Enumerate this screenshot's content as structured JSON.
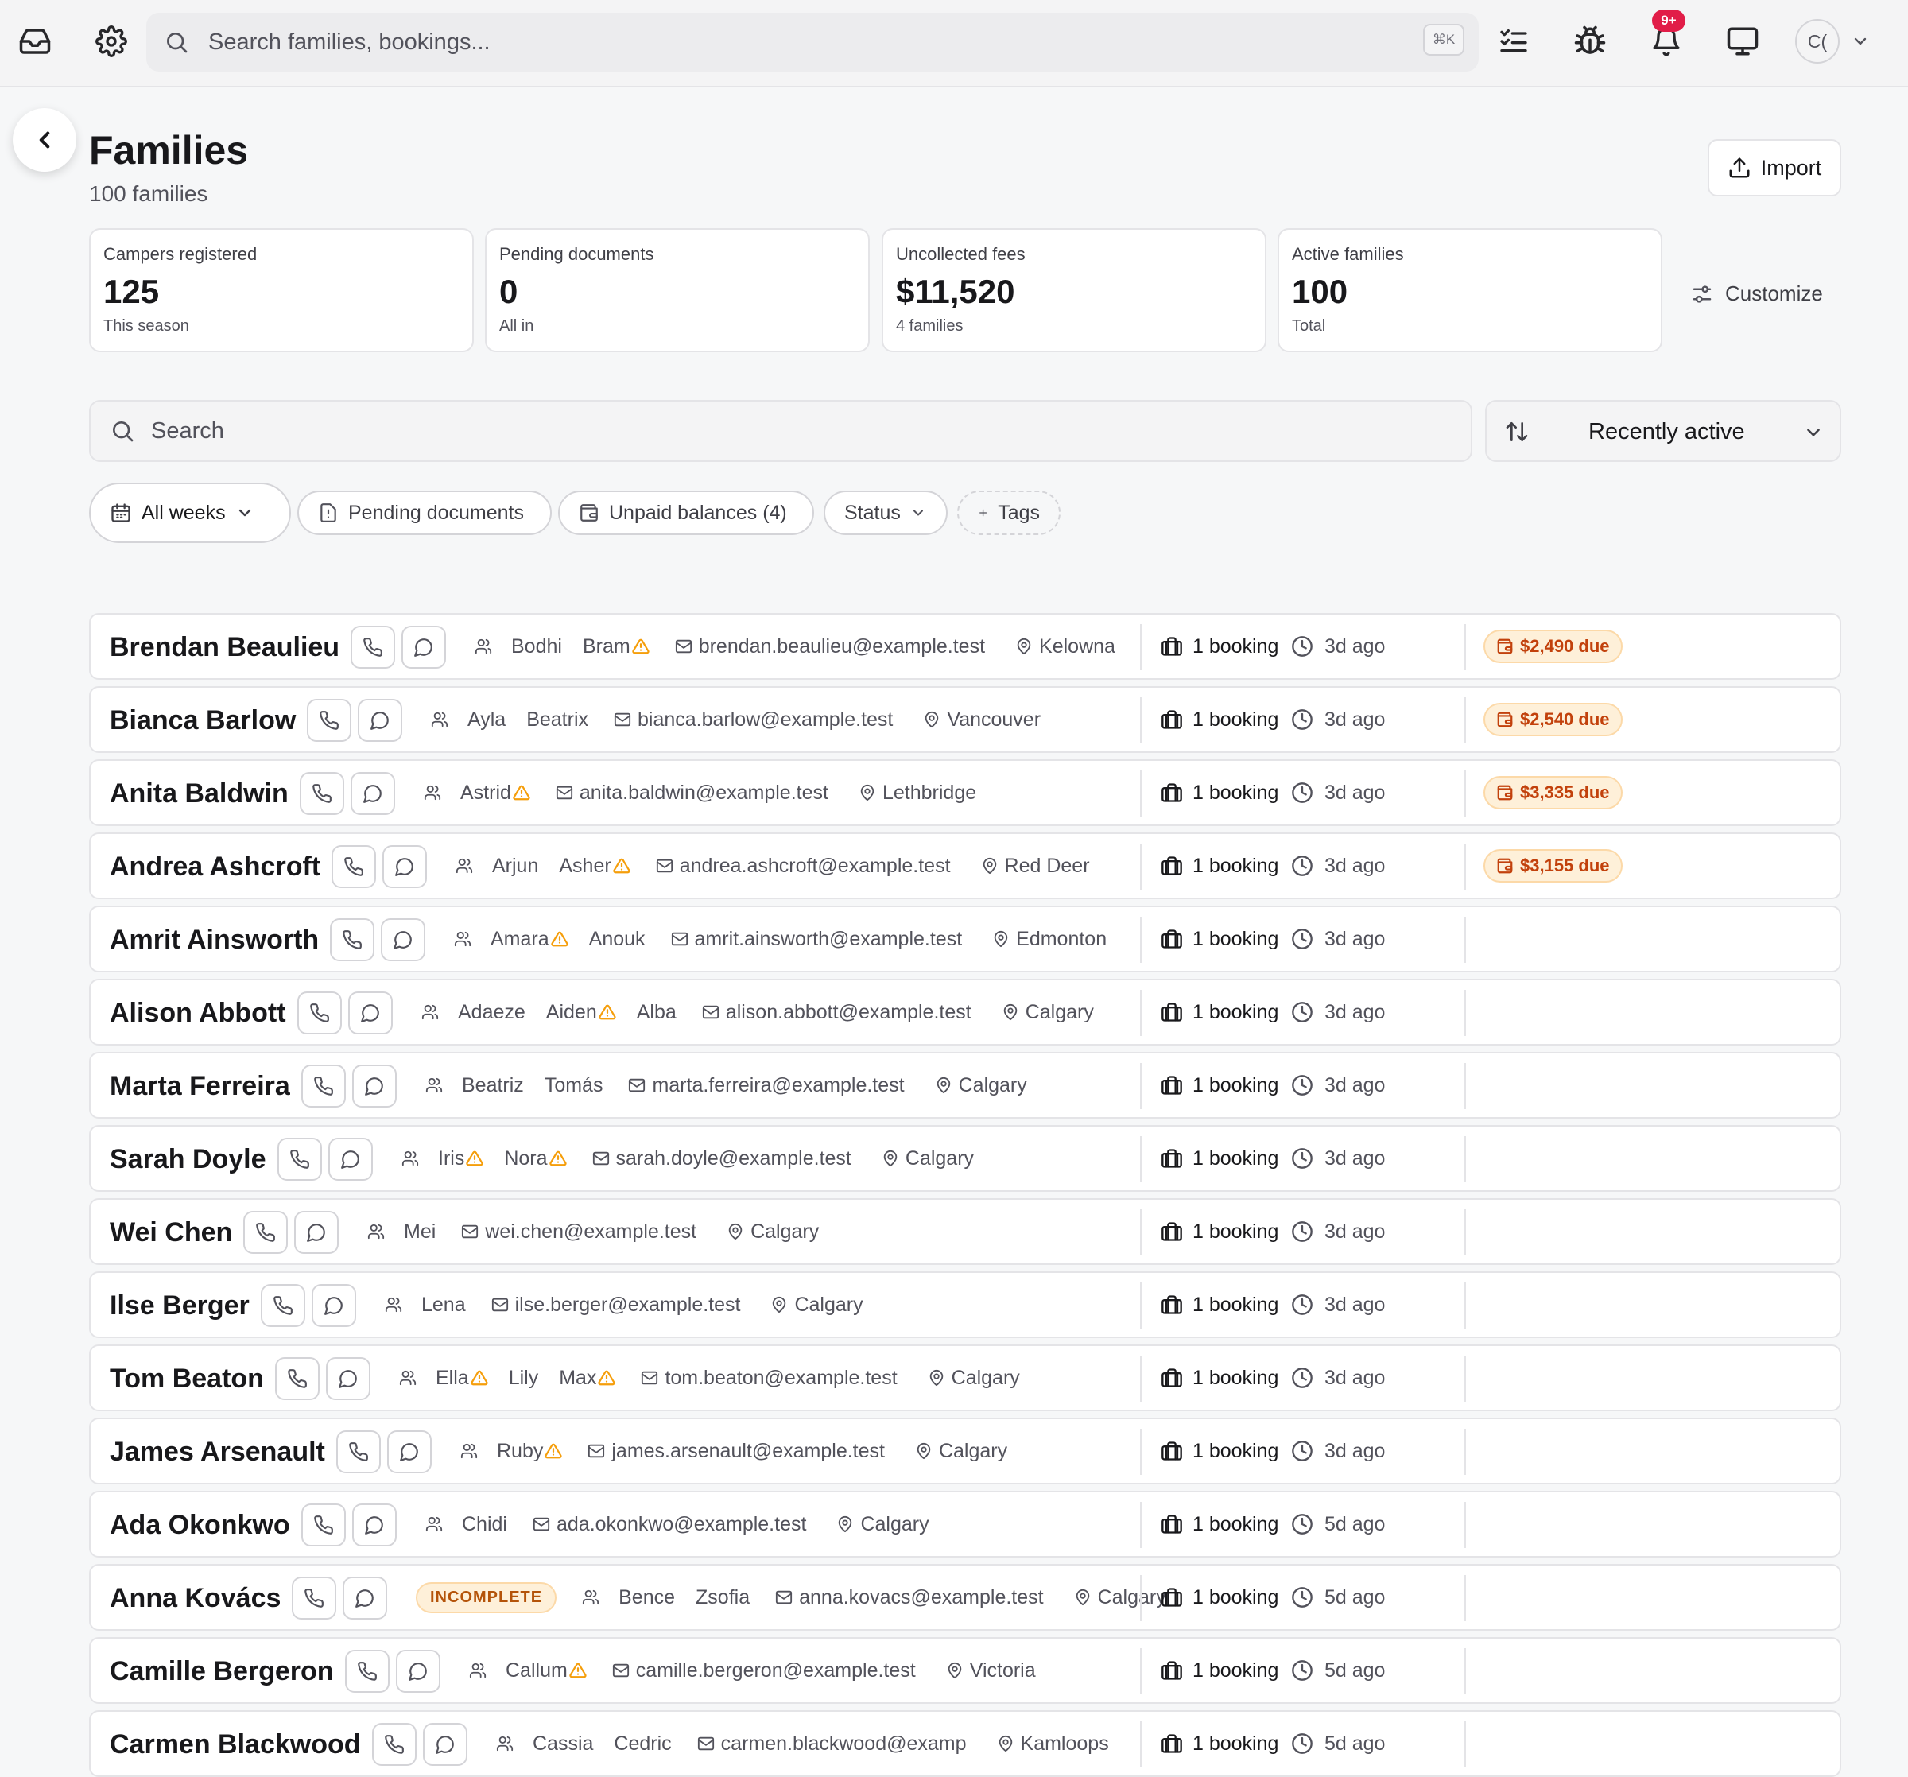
{
  "topbar": {
    "search_placeholder": "Search families, bookings...",
    "shortcut": "⌘K",
    "notification_badge": "9+",
    "avatar_initials": "C("
  },
  "page": {
    "title": "Families",
    "subtitle": "100 families",
    "import_label": "Import",
    "customize_label": "Customize"
  },
  "stats": [
    {
      "label": "Campers registered",
      "value": "125",
      "sub": "This season"
    },
    {
      "label": "Pending documents",
      "value": "0",
      "sub": "All in"
    },
    {
      "label": "Uncollected fees",
      "value": "$11,520",
      "sub": "4 families"
    },
    {
      "label": "Active families",
      "value": "100",
      "sub": "Total"
    }
  ],
  "search": {
    "placeholder": "Search"
  },
  "sort": {
    "label": "Recently active"
  },
  "filters": {
    "weeks": "All weeks",
    "pending": "Pending documents",
    "unpaid": "Unpaid balances (4)",
    "status": "Status",
    "tags": "Tags"
  },
  "families": [
    {
      "name": "Brendan Beaulieu",
      "kids": [
        {
          "n": "Bodhi",
          "w": false
        },
        {
          "n": "Bram",
          "w": true
        }
      ],
      "email": "brendan.beaulieu@example.test",
      "city": "Kelowna",
      "bookings": "1 booking",
      "last": "3d ago",
      "due": "$2,490 due",
      "incomplete": ""
    },
    {
      "name": "Bianca Barlow",
      "kids": [
        {
          "n": "Ayla",
          "w": false
        },
        {
          "n": "Beatrix",
          "w": false
        }
      ],
      "email": "bianca.barlow@example.test",
      "city": "Vancouver",
      "bookings": "1 booking",
      "last": "3d ago",
      "due": "$2,540 due",
      "incomplete": ""
    },
    {
      "name": "Anita Baldwin",
      "kids": [
        {
          "n": "Astrid",
          "w": true
        }
      ],
      "email": "anita.baldwin@example.test",
      "city": "Lethbridge",
      "bookings": "1 booking",
      "last": "3d ago",
      "due": "$3,335 due",
      "incomplete": ""
    },
    {
      "name": "Andrea Ashcroft",
      "kids": [
        {
          "n": "Arjun",
          "w": false
        },
        {
          "n": "Asher",
          "w": true
        }
      ],
      "email": "andrea.ashcroft@example.test",
      "city": "Red Deer",
      "bookings": "1 booking",
      "last": "3d ago",
      "due": "$3,155 due",
      "incomplete": ""
    },
    {
      "name": "Amrit Ainsworth",
      "kids": [
        {
          "n": "Amara",
          "w": true
        },
        {
          "n": "Anouk",
          "w": false
        }
      ],
      "email": "amrit.ainsworth@example.test",
      "city": "Edmonton",
      "bookings": "1 booking",
      "last": "3d ago",
      "due": "",
      "incomplete": ""
    },
    {
      "name": "Alison Abbott",
      "kids": [
        {
          "n": "Adaeze",
          "w": false
        },
        {
          "n": "Aiden",
          "w": true
        },
        {
          "n": "Alba",
          "w": false
        }
      ],
      "email": "alison.abbott@example.test",
      "city": "Calgary",
      "bookings": "1 booking",
      "last": "3d ago",
      "due": "",
      "incomplete": ""
    },
    {
      "name": "Marta Ferreira",
      "kids": [
        {
          "n": "Beatriz",
          "w": false
        },
        {
          "n": "Tomás",
          "w": false
        }
      ],
      "email": "marta.ferreira@example.test",
      "city": "Calgary",
      "bookings": "1 booking",
      "last": "3d ago",
      "due": "",
      "incomplete": ""
    },
    {
      "name": "Sarah Doyle",
      "kids": [
        {
          "n": "Iris",
          "w": true
        },
        {
          "n": "Nora",
          "w": true
        }
      ],
      "email": "sarah.doyle@example.test",
      "city": "Calgary",
      "bookings": "1 booking",
      "last": "3d ago",
      "due": "",
      "incomplete": ""
    },
    {
      "name": "Wei Chen",
      "kids": [
        {
          "n": "Mei",
          "w": false
        }
      ],
      "email": "wei.chen@example.test",
      "city": "Calgary",
      "bookings": "1 booking",
      "last": "3d ago",
      "due": "",
      "incomplete": ""
    },
    {
      "name": "Ilse Berger",
      "kids": [
        {
          "n": "Lena",
          "w": false
        }
      ],
      "email": "ilse.berger@example.test",
      "city": "Calgary",
      "bookings": "1 booking",
      "last": "3d ago",
      "due": "",
      "incomplete": ""
    },
    {
      "name": "Tom Beaton",
      "kids": [
        {
          "n": "Ella",
          "w": true
        },
        {
          "n": "Lily",
          "w": false
        },
        {
          "n": "Max",
          "w": true
        }
      ],
      "email": "tom.beaton@example.test",
      "city": "Calgary",
      "bookings": "1 booking",
      "last": "3d ago",
      "due": "",
      "incomplete": ""
    },
    {
      "name": "James Arsenault",
      "kids": [
        {
          "n": "Ruby",
          "w": true
        }
      ],
      "email": "james.arsenault@example.test",
      "city": "Calgary",
      "bookings": "1 booking",
      "last": "3d ago",
      "due": "",
      "incomplete": ""
    },
    {
      "name": "Ada Okonkwo",
      "kids": [
        {
          "n": "Chidi",
          "w": false
        }
      ],
      "email": "ada.okonkwo@example.test",
      "city": "Calgary",
      "bookings": "1 booking",
      "last": "5d ago",
      "due": "",
      "incomplete": ""
    },
    {
      "name": "Anna Kovács",
      "kids": [
        {
          "n": "Bence",
          "w": false
        },
        {
          "n": "Zsofia",
          "w": false
        }
      ],
      "email": "anna.kovacs@example.test",
      "city": "Calgary",
      "bookings": "1 booking",
      "last": "5d ago",
      "due": "",
      "incomplete": "INCOMPLETE"
    },
    {
      "name": "Camille Bergeron",
      "kids": [
        {
          "n": "Callum",
          "w": true
        }
      ],
      "email": "camille.bergeron@example.test",
      "city": "Victoria",
      "bookings": "1 booking",
      "last": "5d ago",
      "due": "",
      "incomplete": ""
    },
    {
      "name": "Carmen Blackwood",
      "kids": [
        {
          "n": "Cassia",
          "w": false
        },
        {
          "n": "Cedric",
          "w": false
        }
      ],
      "email": "carmen.blackwood@examp",
      "city": "Kamloops",
      "bookings": "1 booking",
      "last": "5d ago",
      "due": "",
      "incomplete": ""
    }
  ]
}
